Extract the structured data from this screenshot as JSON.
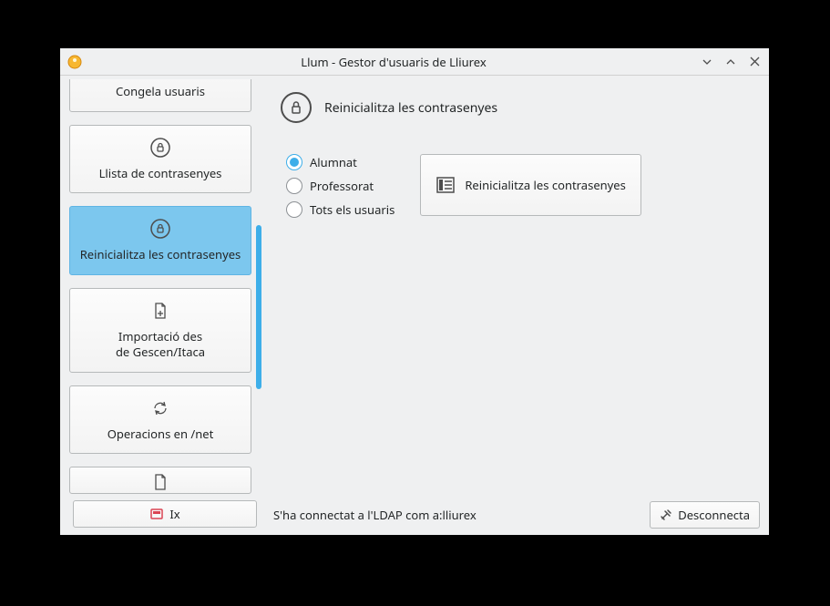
{
  "window": {
    "title": "Llum - Gestor d'usuaris de Lliurex"
  },
  "sidebar": {
    "items": [
      {
        "label": "Congela usuaris",
        "icon": "freeze"
      },
      {
        "label": "Llista de contrasenyes",
        "icon": "lock"
      },
      {
        "label": "Reinicialitza les contrasenyes",
        "icon": "lock",
        "active": true
      },
      {
        "label": "Importació des\nde Gescen/Itaca",
        "icon": "import"
      },
      {
        "label": "Operacions en /net",
        "icon": "sync"
      }
    ],
    "exit_label": "Ix"
  },
  "main": {
    "title": "Reinicialitza les contrasenyes",
    "radios": {
      "opt1": "Alumnat",
      "opt2": "Professorat",
      "opt3": "Tots els usuaris"
    },
    "action_label": "Reinicialitza les contrasenyes"
  },
  "status": {
    "text": "S'ha connectat a l'LDAP com a:lliurex",
    "disconnect": "Desconnecta"
  }
}
